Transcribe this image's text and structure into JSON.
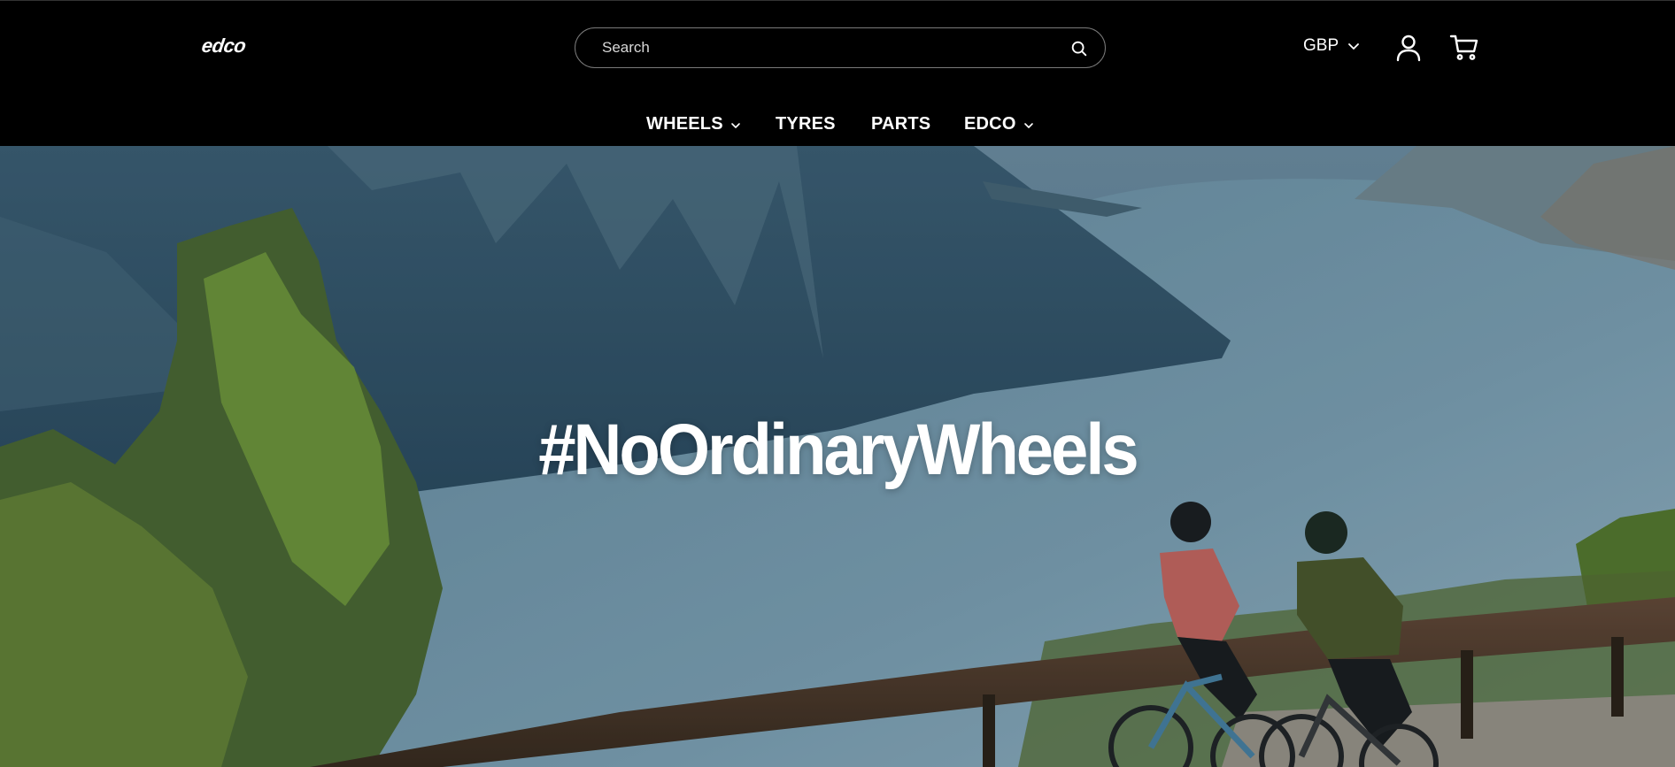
{
  "header": {
    "logo_text": "edco",
    "search": {
      "placeholder": "Search",
      "value": ""
    },
    "currency": {
      "selected": "GBP",
      "icon": "chevron-down-icon"
    },
    "icons": {
      "account": "user-icon",
      "cart": "cart-icon",
      "search": "search-icon"
    }
  },
  "nav": {
    "items": [
      {
        "label": "WHEELS",
        "has_dropdown": true
      },
      {
        "label": "TYRES",
        "has_dropdown": false
      },
      {
        "label": "PARTS",
        "has_dropdown": false
      },
      {
        "label": "EDCO",
        "has_dropdown": true
      }
    ]
  },
  "hero": {
    "heading": "#NoOrdinaryWheels"
  },
  "colors": {
    "header_bg": "#000000",
    "text": "#ffffff",
    "search_border": "#7a7a7a"
  }
}
